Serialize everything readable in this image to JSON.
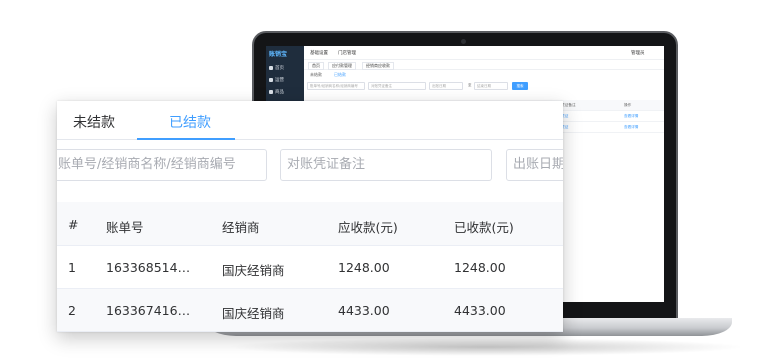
{
  "mini_app": {
    "logo": "账销宝",
    "nav": [
      "首页",
      "运营",
      "商品"
    ],
    "top_items": [
      "基础设置",
      "门店管理"
    ],
    "top_right": [
      "管理员"
    ],
    "tabs": [
      "首页",
      "应付款管理",
      "经销商应收款"
    ],
    "subtabs": [
      "未结款",
      "已结款"
    ],
    "filters": [
      "账单号/经销商名称/经销商编号",
      "对账凭证备注",
      "出账日期",
      "至",
      "结束日期"
    ],
    "search_btn": "搜索",
    "col_headers": [
      "对账凭证备注",
      "操作"
    ],
    "rows": [
      {
        "note": "查看凭证",
        "action": "查看详情"
      },
      {
        "note": "查看凭证",
        "action": "查看详情"
      }
    ]
  },
  "tabs": {
    "unsettled": "未结款",
    "settled": "已结款"
  },
  "filters": {
    "bill_search_placeholder": "账单号/经销商名称/经销商编号",
    "voucher_note_placeholder": "对账凭证备注",
    "bill_date_placeholder": "出账日期"
  },
  "table": {
    "headers": {
      "index": "#",
      "bill_no": "账单号",
      "dealer": "经销商",
      "receivable": "应收款(元)",
      "received": "已收款(元)"
    },
    "rows": [
      {
        "index": "1",
        "bill_no": "16336851419...",
        "dealer": "国庆经销商",
        "receivable": "1248.00",
        "received": "1248.00"
      },
      {
        "index": "2",
        "bill_no": "16336741654...",
        "dealer": "国庆经销商",
        "receivable": "4433.00",
        "received": "4433.00"
      }
    ]
  },
  "colors": {
    "accent": "#409eff",
    "sidebar": "#1f2d3d"
  }
}
